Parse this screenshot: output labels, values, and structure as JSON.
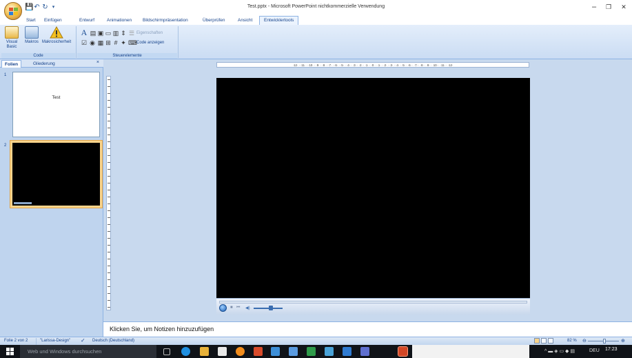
{
  "window": {
    "title": "Test.pptx - Microsoft PowerPoint nichtkommerzielle Verwendung",
    "minimize": "–",
    "maximize": "❐",
    "close": "✕"
  },
  "qat": {
    "save": "💾",
    "undo": "↶",
    "redo": "↻",
    "more": "▾"
  },
  "ribbon": {
    "tabs": [
      {
        "label": "Start"
      },
      {
        "label": "Einfügen"
      },
      {
        "label": "Entwurf"
      },
      {
        "label": "Animationen"
      },
      {
        "label": "Bildschirmpräsentation"
      },
      {
        "label": "Überprüfen"
      },
      {
        "label": "Ansicht"
      },
      {
        "label": "Entwicklertools",
        "active": true
      }
    ],
    "code_group": {
      "label": "Code",
      "buttons": [
        "Visual Basic",
        "Makros",
        "Makrosicherheit"
      ]
    },
    "controls_group": {
      "label": "Steuerelemente",
      "properties": "Eigenschaften",
      "view_code": "Code anzeigen"
    }
  },
  "left_panel": {
    "tabs": [
      "Folien",
      "Gliederung"
    ],
    "close": "×",
    "slides": [
      {
        "number": "1",
        "title": "Test"
      },
      {
        "number": "2",
        "title": ""
      }
    ]
  },
  "ruler": {
    "horizontal": "·12· · ·11· · ·10· · ·9· · ·8· · ·7· · ·6· · ·5· · ·4· · ·3· · ·2· · ·1· · ·0· · ·1· · ·2· · ·3· · ·4· · ·5· · ·6· · ·7· · ·8· · ·9· · ·10· · ·11· · ·12·"
  },
  "notes": {
    "placeholder": "Klicken Sie, um Notizen hinzuzufügen"
  },
  "statusbar": {
    "slide_info": "Folie 2 von 2",
    "theme": "\"Larissa-Design\"",
    "language": "Deutsch (Deutschland)",
    "zoom": "82 %"
  },
  "taskbar": {
    "search_placeholder": "Web und Windows durchsuchen",
    "tray_lang": "DEU",
    "clock": "17:23"
  },
  "colors": {
    "ribbon_bg": "#dce8f7",
    "panel_bg": "#bfd4ee",
    "selected_thumb": "#f9d48c",
    "taskbar": "#101318"
  }
}
